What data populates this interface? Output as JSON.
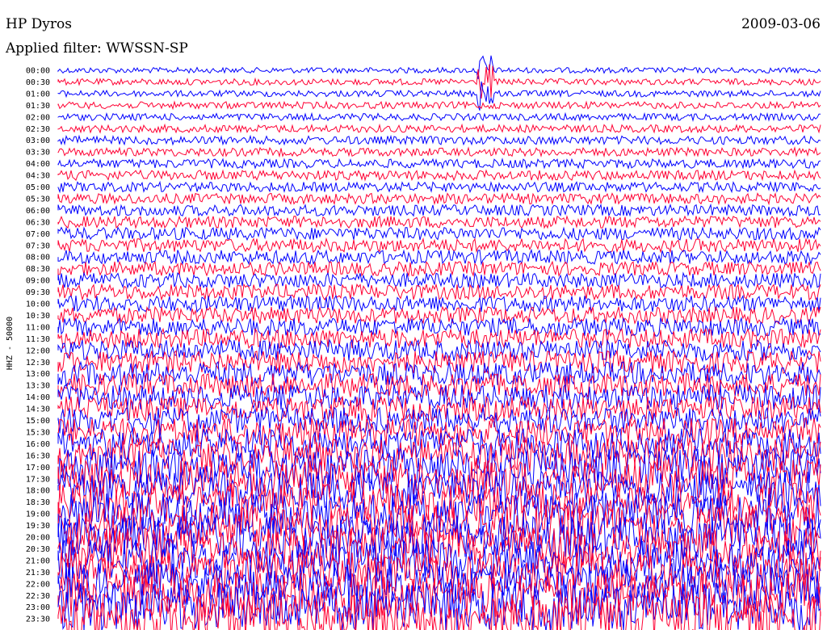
{
  "header": {
    "station": "HP Dyros",
    "filter": "Applied filter: WWSSN-SP",
    "date": "2009-03-06"
  },
  "chart_data": {
    "type": "line",
    "title": "HP Dyros",
    "subtitle": "Applied filter: WWSSN-SP",
    "date": "2009-03-06",
    "ylabel": "HHZ - 50000",
    "xlabel": "",
    "series_colors": [
      "#0000ff",
      "#ff0033"
    ],
    "hour_labels": [
      "00:00",
      "00:30",
      "01:00",
      "01:30",
      "02:00",
      "02:30",
      "03:00",
      "03:30",
      "04:00",
      "04:30",
      "05:00",
      "05:30",
      "06:00",
      "06:30",
      "07:00",
      "07:30",
      "08:00",
      "08:30",
      "09:00",
      "09:30",
      "10:00",
      "10:30",
      "11:00",
      "11:30",
      "12:00",
      "12:30",
      "13:00",
      "13:30",
      "14:00",
      "14:30",
      "15:00",
      "15:30",
      "16:00",
      "16:30",
      "17:00",
      "17:30",
      "18:00",
      "18:30",
      "19:00",
      "19:30",
      "20:00",
      "20:30",
      "21:00",
      "21:30",
      "22:00",
      "22:30",
      "23:00",
      "23:30"
    ],
    "trace_amplitude": [
      0.4,
      0.45,
      0.45,
      0.5,
      0.5,
      0.55,
      0.6,
      0.6,
      0.65,
      0.7,
      0.7,
      0.75,
      0.8,
      0.85,
      0.9,
      0.95,
      1.0,
      1.0,
      1.05,
      1.1,
      1.15,
      1.2,
      1.3,
      1.4,
      1.5,
      1.6,
      1.7,
      1.7,
      1.8,
      1.8,
      1.9,
      2.0,
      2.2,
      2.4,
      2.6,
      2.7,
      2.8,
      2.9,
      3.0,
      3.0,
      3.0,
      3.0,
      3.0,
      3.0,
      3.0,
      3.2,
      3.5,
      3.5
    ],
    "events": [
      {
        "time": "00:00",
        "position": 0.56,
        "note": "large transient"
      }
    ]
  }
}
